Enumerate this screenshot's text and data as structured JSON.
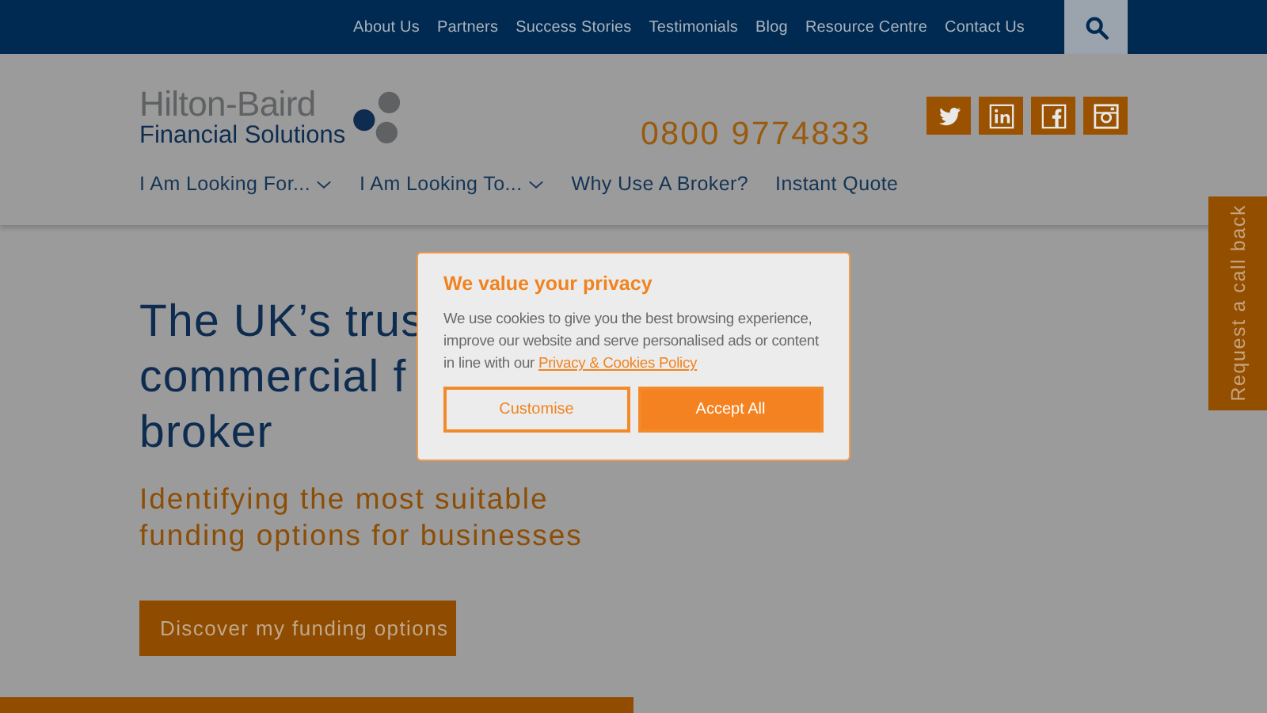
{
  "top_nav": {
    "links": [
      "About Us",
      "Partners",
      "Success Stories",
      "Testimonials",
      "Blog",
      "Resource Centre",
      "Contact Us"
    ]
  },
  "header": {
    "logo": {
      "line_1": "Hilton-Baird",
      "line_2": "Financial Solutions"
    },
    "phone": "0800 9774833",
    "social": [
      {
        "kind": "twitter"
      },
      {
        "kind": "linkedin"
      },
      {
        "kind": "facebook"
      },
      {
        "kind": "instagram"
      }
    ],
    "menu": [
      {
        "label": "I Am Looking For...",
        "dropdown": true
      },
      {
        "label": "I Am Looking To...",
        "dropdown": true
      },
      {
        "label": "Why Use A Broker?",
        "dropdown": false
      },
      {
        "label": "Instant Quote",
        "dropdown": false
      }
    ]
  },
  "hero": {
    "headline_lines": [
      "The UK’s trus",
      "commercial f",
      "broker"
    ],
    "subtitle": "Identifying the most suitable funding options for businesses",
    "button": "Discover my funding options"
  },
  "callback_tab": "Request a call back",
  "cookie_dialog": {
    "title": "We value your privacy",
    "text": "We use cookies to give you the best browsing experience, improve our website and serve personalised ads or content in line with our",
    "link": "Privacy & Cookies Policy",
    "buttons": [
      {
        "label": "Customise",
        "kind": "outline"
      },
      {
        "label": "Accept All",
        "kind": "filled"
      }
    ]
  }
}
